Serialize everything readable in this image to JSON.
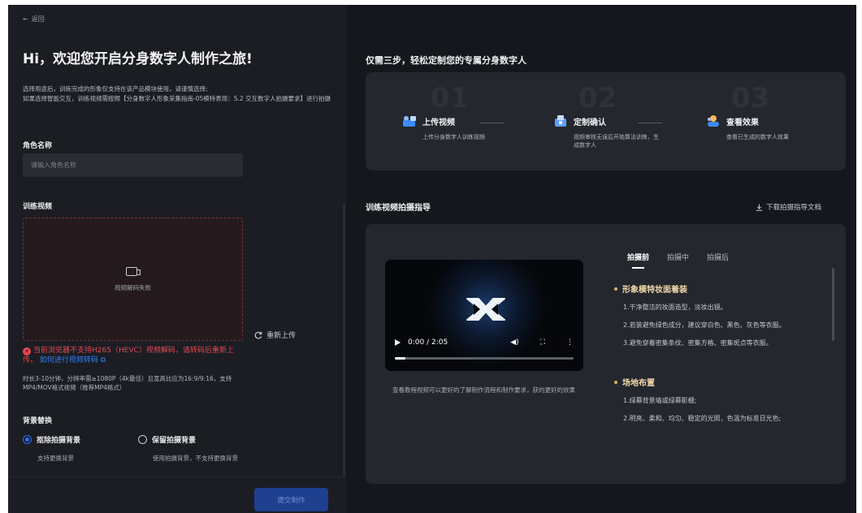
{
  "header": {
    "back_label": "返回",
    "back_icon": "arrow-left-icon"
  },
  "left": {
    "title": "Hi，欢迎您开启分身数字人制作之旅!",
    "desc_line1": "选择用途后，训练完成的形象仅支持在该产品模块使用，请谨慎选择;",
    "desc_line2": "如果选择智能交互，训练视频需按照【分身数字人形象采集指南-05模特表现：5.2 交互数字人拍摄要求】进行拍摄",
    "role_label": "角色名称",
    "role_placeholder": "请输入角色名称",
    "video_label": "训练视频",
    "upload_fail": "视频解码失败",
    "reupload": "重新上传",
    "error_text": "当前浏览器不支持H265（HEVC）视频解码，请转码后重新上传。",
    "error_link": "如何进行视频转码",
    "hint": "时长3-10分钟，分辨率需≥1080P（4k最佳）且宽高比应为16:9/9:16，支持MP4/MOV格式视频（推荐MP4格式）",
    "bg_label": "背景替换",
    "option1_label": "抠除拍摄背景",
    "option1_sub": "支持更换背景",
    "option2_label": "保留拍摄背景",
    "option2_sub": "使用拍摄背景，不支持更换背景",
    "submit": "提交制作"
  },
  "right": {
    "title": "仅需三步，轻松定制您的专属分身数字人",
    "steps": [
      {
        "num": "01",
        "title": "上传视频",
        "sub": "上传分身数字人训练视频",
        "icon": "upload-video-icon"
      },
      {
        "num": "02",
        "title": "定制确认",
        "sub": "视频审核无误后开始算法训练，生成数字人",
        "icon": "customize-confirm-icon"
      },
      {
        "num": "03",
        "title": "查看效果",
        "sub": "查看已生成的数字人效果",
        "icon": "view-result-icon"
      }
    ],
    "guide_title": "训练视频拍摄指导",
    "download": "下载拍摄指导文档",
    "video_time": "0:00 / 2:05",
    "video_progress": 0.06,
    "video_caption": "查看教程视频可以更好的了解制作流程和制作要求，获的更好的效果",
    "tabs": [
      "拍摄前",
      "拍摄中",
      "拍摄后"
    ],
    "active_tab": 0,
    "sections": [
      {
        "title": "形象模特妆面着装",
        "items": [
          "1.干净整洁的妆面造型，淡妆出镜。",
          "2.若装避免绿色成分，建议穿白色、黑色、灰色等衣服。",
          "3.避免穿着密集条纹、密集方格、密集斑点等衣服。"
        ]
      },
      {
        "title": "场地布置",
        "items": [
          "1.绿幕背景墙或绿幕影棚;",
          "2.明亮、柔和、均匀、稳定的光照，色温为标准日光色;"
        ]
      }
    ]
  },
  "colors": {
    "accent": "#2f6dff",
    "error": "#e8484f",
    "section_title": "#f0d9a8"
  }
}
